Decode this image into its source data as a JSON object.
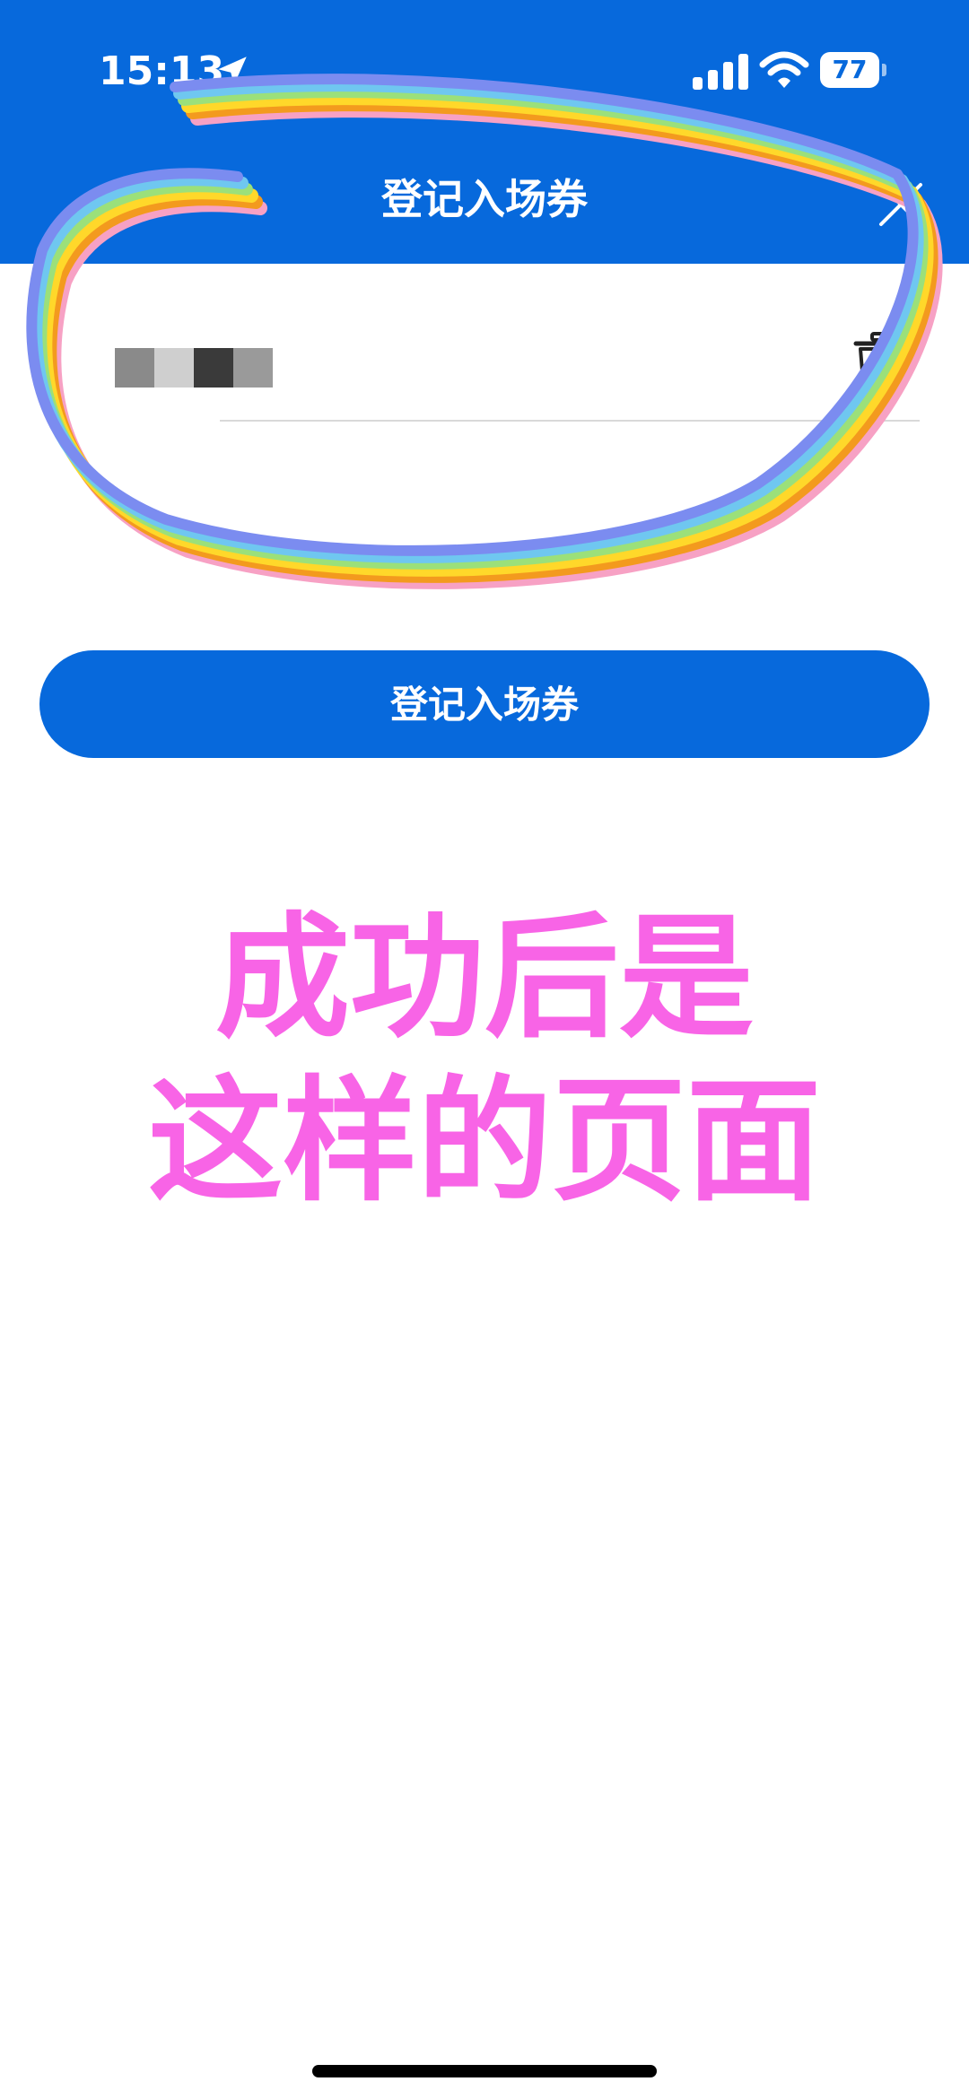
{
  "status_bar": {
    "time": "15:13",
    "battery": "77"
  },
  "header": {
    "title": "登记入场券"
  },
  "ticket_list": {
    "items": [
      {
        "code": "",
        "redacted": true
      }
    ]
  },
  "register_button": {
    "label": "登记入场券"
  },
  "annotation": {
    "line1": "成功后是",
    "line2": "这样的页面",
    "color": "#F864E6"
  },
  "colors": {
    "brand": "#0769DC",
    "background": "#FFFFFF",
    "divider": "#D9D9D9"
  },
  "icons": {
    "location": "location-arrow-icon",
    "signal": "cellular-signal-icon",
    "wifi": "wifi-icon",
    "battery": "battery-icon",
    "close": "close-icon",
    "delete": "trash-icon"
  }
}
